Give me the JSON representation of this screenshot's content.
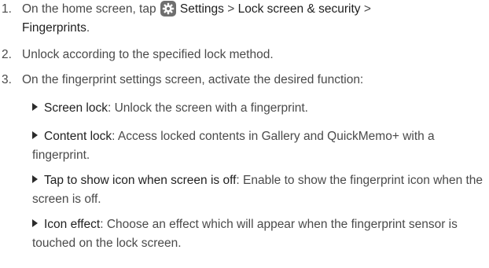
{
  "steps": [
    {
      "number": "1.",
      "prefix": "On the home screen, tap ",
      "settings": "Settings",
      "sep1": " > ",
      "lock_screen": "Lock screen & security",
      "sep2": " >",
      "fingerprints": "Fingerprints",
      "suffix": "."
    },
    {
      "number": "2.",
      "text": "Unlock according to the specified lock method."
    },
    {
      "number": "3.",
      "text": "On the fingerprint settings screen, activate the desired function:"
    }
  ],
  "functions": [
    {
      "term": "Screen lock",
      "desc": ": Unlock the screen with a fingerprint."
    },
    {
      "term": "Content lock",
      "desc": ": Access locked contents in Gallery and QuickMemo+ with a fingerprint."
    },
    {
      "term": "Tap to show icon when screen is off",
      "desc": ": Enable to show the fingerprint icon when the screen is off."
    },
    {
      "term": "Icon effect",
      "desc": ": Choose an effect which will appear when the fingerprint sensor is touched on the lock screen."
    }
  ],
  "icons": {
    "settings": "gear-icon",
    "bullet": "triangle-bullet-icon"
  }
}
